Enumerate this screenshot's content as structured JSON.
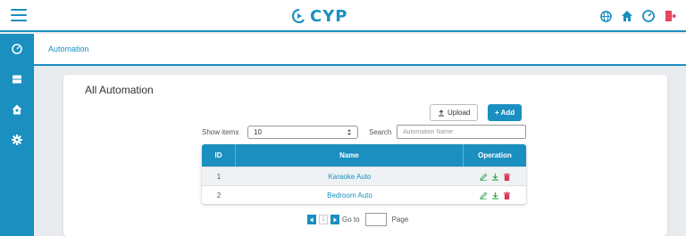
{
  "header": {
    "logo_text": "CYP",
    "icons": [
      "globe-icon",
      "home-icon",
      "dashboard-icon",
      "logout-icon"
    ],
    "accent_color": "#1a8fc0"
  },
  "sidebar": {
    "items": [
      {
        "icon": "dashboard-icon"
      },
      {
        "icon": "server-icon"
      },
      {
        "icon": "home-user-icon"
      },
      {
        "icon": "gear-icon"
      }
    ]
  },
  "breadcrumb": {
    "current": "Automation"
  },
  "card": {
    "title": "All Automation",
    "upload_label": "Upload",
    "add_label": "+ Add",
    "show_items_label": "Show items",
    "show_items_value": "10",
    "search_label": "Search",
    "search_placeholder": "Automation Name"
  },
  "table": {
    "headers": [
      "ID",
      "Name",
      "Operation"
    ],
    "rows": [
      {
        "id": "1",
        "name": "Karaoke Auto"
      },
      {
        "id": "2",
        "name": "Bedroom Auto"
      }
    ]
  },
  "pagination": {
    "current_page": "1",
    "goto_label": "Go to",
    "page_label": "Page"
  }
}
